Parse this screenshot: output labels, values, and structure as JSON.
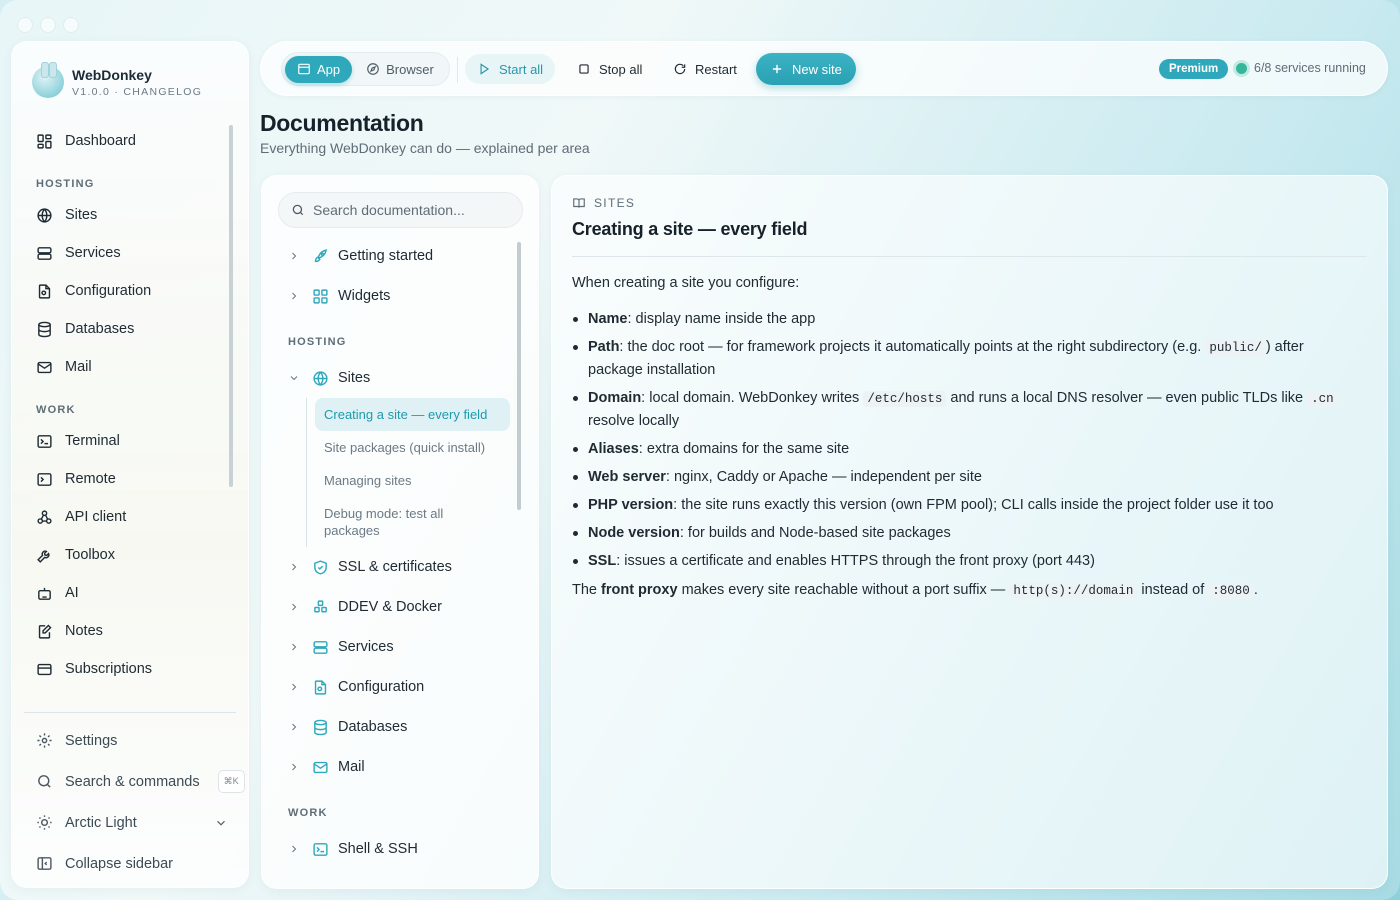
{
  "brand": {
    "name": "WebDonkey",
    "subtitle": "V1.0.0 · CHANGELOG"
  },
  "sidebar": {
    "dashboard": "Dashboard",
    "hosting_label": "HOSTING",
    "hosting": [
      "Sites",
      "Services",
      "Configuration",
      "Databases",
      "Mail"
    ],
    "work_label": "WORK",
    "work": [
      "Terminal",
      "Remote",
      "API client",
      "Toolbox",
      "AI",
      "Notes",
      "Subscriptions"
    ],
    "settings": "Settings",
    "search_commands": "Search & commands",
    "search_shortcut": "⌘K",
    "theme": "Arctic Light",
    "collapse": "Collapse sidebar"
  },
  "toolbar": {
    "mode_app": "App",
    "mode_browser": "Browser",
    "start_all": "Start all",
    "stop_all": "Stop all",
    "restart": "Restart",
    "new_site": "New site",
    "badge": "Premium",
    "status": "6/8 services running"
  },
  "page": {
    "title": "Documentation",
    "subtitle": "Everything WebDonkey can do — explained per area"
  },
  "docnav": {
    "search_placeholder": "Search documentation...",
    "getting_started": "Getting started",
    "widgets": "Widgets",
    "hosting_label": "HOSTING",
    "sites": "Sites",
    "sites_children": [
      "Creating a site — every field",
      "Site packages (quick install)",
      "Managing sites",
      "Debug mode: test all packages"
    ],
    "ssl": "SSL & certificates",
    "ddev": "DDEV & Docker",
    "services": "Services",
    "configuration": "Configuration",
    "databases": "Databases",
    "mail": "Mail",
    "work_label": "WORK",
    "shell": "Shell & SSH"
  },
  "content": {
    "crumb": "SITES",
    "title": "Creating a site — every field",
    "intro": "When creating a site you configure:",
    "f_name_label": "Name",
    "f_name_text": ": display name inside the app",
    "f_path_label": "Path",
    "f_path_text1": ": the doc root — for framework projects it automatically points at the right subdirectory (e.g. ",
    "f_path_code": "public/",
    "f_path_text2": ") after package installation",
    "f_domain_label": "Domain",
    "f_domain_text1": ": local domain. WebDonkey writes ",
    "f_domain_code1": "/etc/hosts",
    "f_domain_text2": " and runs a local DNS resolver — even public TLDs like ",
    "f_domain_code2": ".cn",
    "f_domain_text3": " resolve locally",
    "f_aliases_label": "Aliases",
    "f_aliases_text": ": extra domains for the same site",
    "f_web_label": "Web server",
    "f_web_text": ": nginx, Caddy or Apache — independent per site",
    "f_php_label": "PHP version",
    "f_php_text": ": the site runs exactly this version (own FPM pool); CLI calls inside the project folder use it too",
    "f_node_label": "Node version",
    "f_node_text": ": for builds and Node-based site packages",
    "f_ssl_label": "SSL",
    "f_ssl_text": ": issues a certificate and enables HTTPS through the front proxy (port 443)",
    "outro_text1": "The ",
    "outro_bold": "front proxy",
    "outro_text2": " makes every site reachable without a port suffix — ",
    "outro_code1": "http(s)://domain",
    "outro_text3": " instead of ",
    "outro_code2": ":8080",
    "outro_text4": "."
  },
  "colors": {
    "accent": "#2fa8bb",
    "status_ok": "#36b79b"
  }
}
